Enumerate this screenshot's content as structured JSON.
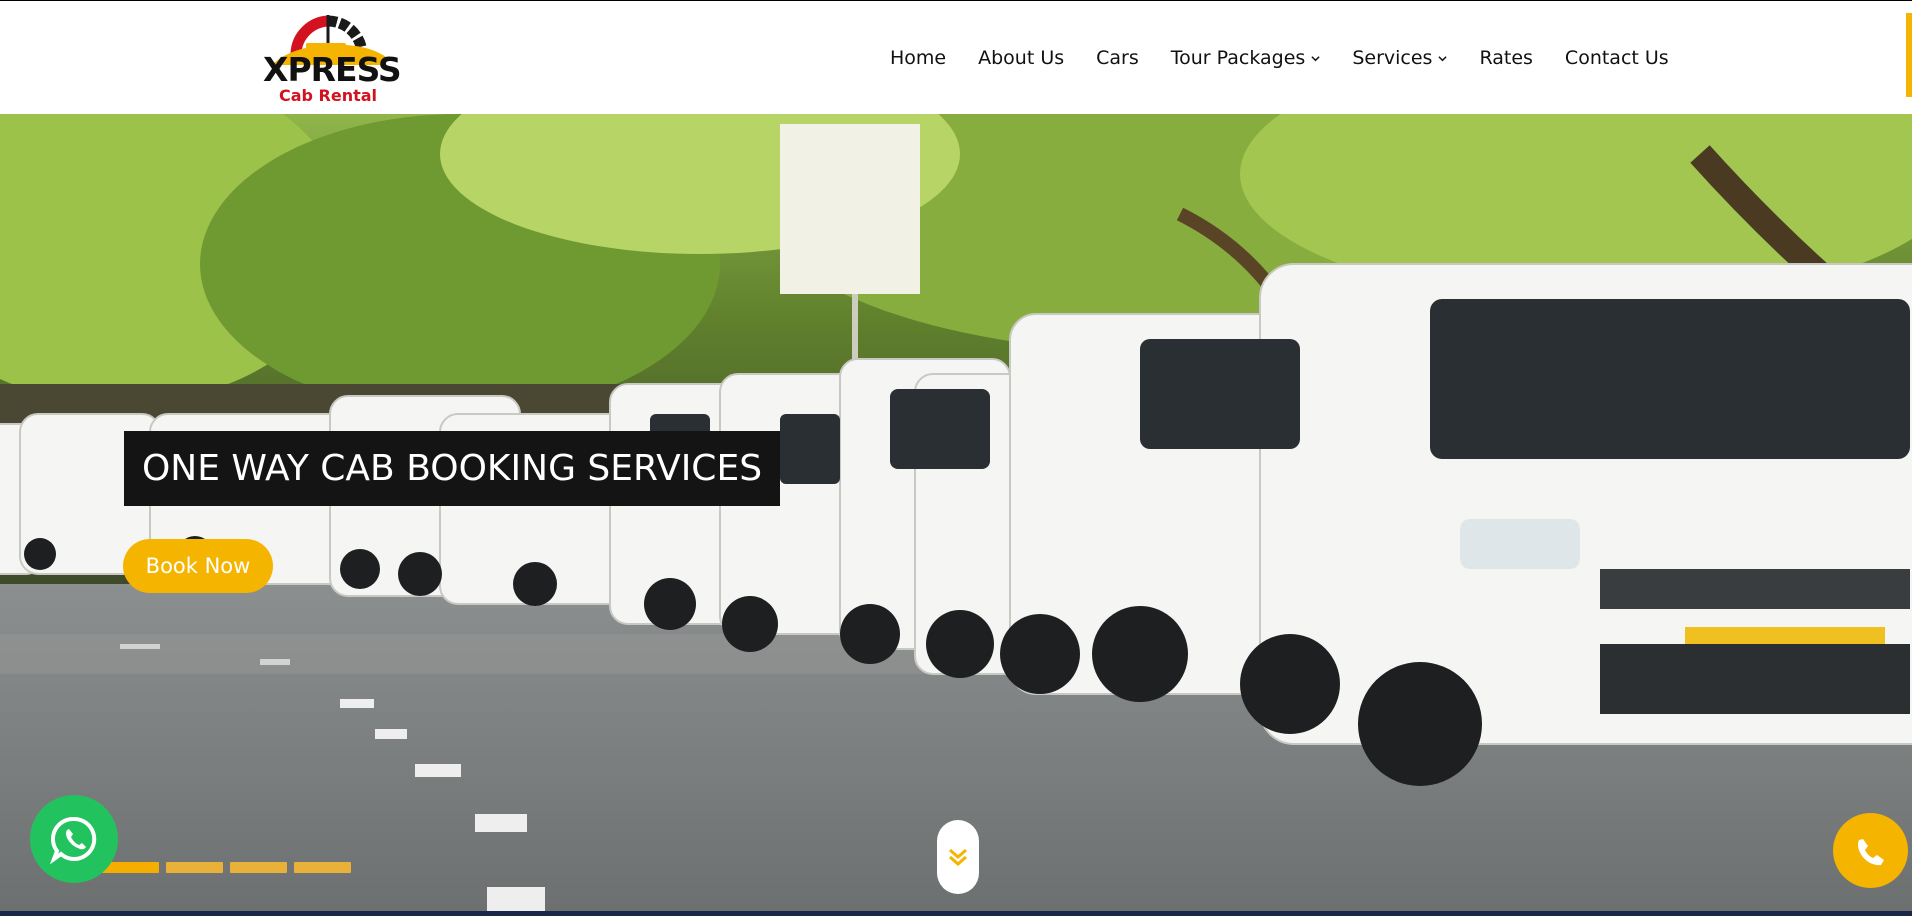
{
  "brand": {
    "name": "XPRESS",
    "tagline": "Cab Rental",
    "accent_color": "#f5b400",
    "brand_red": "#d3121f"
  },
  "nav": {
    "items": [
      {
        "label": "Home",
        "has_dropdown": false
      },
      {
        "label": "About Us",
        "has_dropdown": false
      },
      {
        "label": "Cars",
        "has_dropdown": false
      },
      {
        "label": "Tour Packages",
        "has_dropdown": true,
        "icon": "chevron-down-icon"
      },
      {
        "label": "Services",
        "has_dropdown": true,
        "icon": "chevron-down-icon"
      },
      {
        "label": "Rates",
        "has_dropdown": false
      },
      {
        "label": "Contact Us",
        "has_dropdown": false
      }
    ]
  },
  "hero": {
    "title": "ONE WAY CAB BOOKING SERVICES",
    "cta_label": "Book Now",
    "slider": {
      "slide_count": 4,
      "active_index": 0
    },
    "scroll_icon": "double-chevron-down-icon"
  },
  "floating": {
    "whatsapp_icon": "whatsapp-icon",
    "phone_icon": "phone-icon"
  }
}
